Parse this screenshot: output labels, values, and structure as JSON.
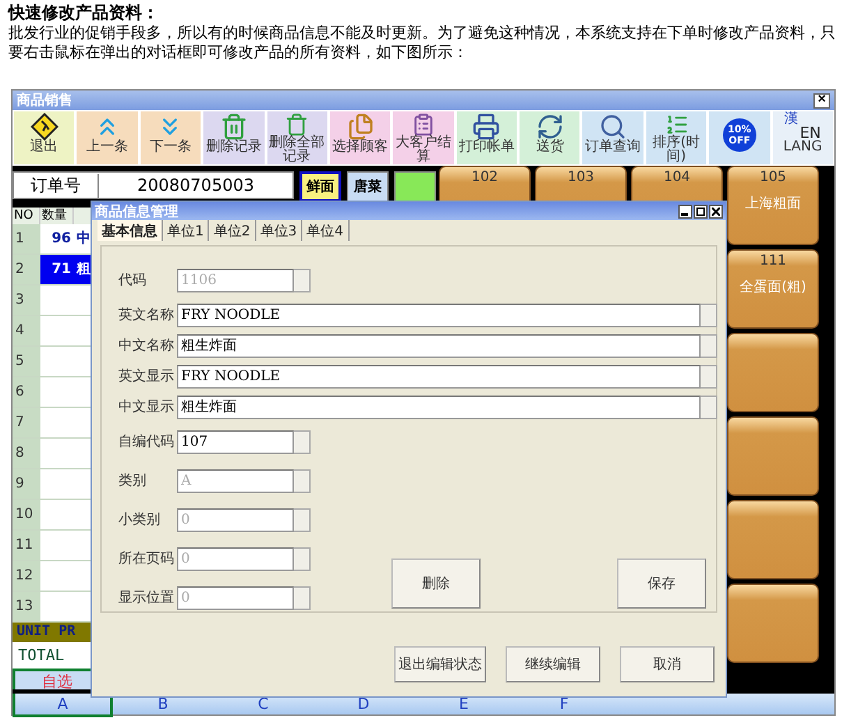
{
  "heading": "快速修改产品资料：",
  "intro": "批发行业的促销手段多，所以有的时候商品信息不能及时更新。为了避免这种情况，本系统支持在下单时修改产品资料，只要右击鼠标在弹出的对话框即可修改产品的所有资料，如下图所示：",
  "window": {
    "title": "商品销售",
    "close": "×"
  },
  "toolbar": [
    {
      "label": "退出",
      "color": "#eef3c4"
    },
    {
      "label": "上一条",
      "color": "#f6dcbc"
    },
    {
      "label": "下一条",
      "color": "#f6dcbc"
    },
    {
      "label": "删除记录",
      "color": "#dcd8f0"
    },
    {
      "label": "删除全部记录",
      "color": "#dcd8f0"
    },
    {
      "label": "选择顾客",
      "color": "#f4d0e8"
    },
    {
      "label": "大客户结算",
      "color": "#f4d0e8"
    },
    {
      "label": "打印帐单",
      "color": "#d4f0d8"
    },
    {
      "label": "送货",
      "color": "#d4f0d8"
    },
    {
      "label": "订单查询",
      "color": "#d0e4f4"
    },
    {
      "label": "排序(时间)",
      "color": "#d0e4f4"
    },
    {
      "badge": "10% OFF",
      "color": "#d0e4f4"
    },
    {
      "label": "LANG",
      "glyphs": [
        "漢",
        "EN"
      ],
      "color": "#e8f0f8"
    }
  ],
  "order": {
    "label": "订单号",
    "number": "20080705003"
  },
  "categories": [
    {
      "label": "鲜面",
      "selected": true,
      "color": "#f8f080"
    },
    {
      "label": "唐菜",
      "selected": false,
      "color": "#c8dcf4"
    },
    {
      "selected": false,
      "color": "#88e858"
    }
  ],
  "order_table": {
    "columns": [
      "NO",
      "数量"
    ],
    "rows": [
      {
        "no": "1",
        "qty": "96",
        "name": "中",
        "selected": false
      },
      {
        "no": "2",
        "qty": "71",
        "name": "粗",
        "selected": true
      },
      {
        "no": "3",
        "selected": false
      },
      {
        "no": "4",
        "selected": false
      },
      {
        "no": "5",
        "selected": false
      },
      {
        "no": "6",
        "selected": false
      },
      {
        "no": "7",
        "selected": false
      },
      {
        "no": "8",
        "selected": false
      },
      {
        "no": "9",
        "selected": false
      },
      {
        "no": "10",
        "selected": false
      },
      {
        "no": "11",
        "selected": false
      },
      {
        "no": "12",
        "selected": false
      },
      {
        "no": "13",
        "selected": false
      }
    ],
    "unit_price_label": "UNIT PR",
    "total_label": "TOTAL",
    "custom_label": "自选"
  },
  "products": [
    {
      "kind": "item",
      "code": "102"
    },
    {
      "kind": "item",
      "code": "103"
    },
    {
      "kind": "item",
      "code": "104"
    },
    {
      "kind": "item",
      "code": "105",
      "name": "上海粗面"
    },
    {
      "kind": "item",
      "code": "111",
      "name": "全蛋面(粗)"
    },
    {
      "kind": "blank"
    },
    {
      "kind": "blank"
    },
    {
      "kind": "blank"
    },
    {
      "kind": "blank"
    }
  ],
  "column_letters": [
    {
      "letter": "A",
      "selected": true
    },
    {
      "letter": "B",
      "selected": false
    },
    {
      "letter": "C",
      "selected": false
    },
    {
      "letter": "D",
      "selected": false
    },
    {
      "letter": "E",
      "selected": false
    },
    {
      "letter": "F",
      "selected": false
    }
  ],
  "dialog": {
    "title": "商品信息管理",
    "tabs": [
      {
        "label": "基本信息",
        "selected": true
      },
      {
        "label": "单位1",
        "selected": false
      },
      {
        "label": "单位2",
        "selected": false
      },
      {
        "label": "单位3",
        "selected": false
      },
      {
        "label": "单位4",
        "selected": false
      }
    ],
    "fields": [
      {
        "label": "代码",
        "value": "1106",
        "kind": "short",
        "disabled": true
      },
      {
        "label": "英文名称",
        "value": "FRY NOODLE",
        "kind": "long",
        "disabled": false
      },
      {
        "label": "中文名称",
        "value": "粗生炸面",
        "kind": "long",
        "disabled": false
      },
      {
        "label": "英文显示",
        "value": "FRY NOODLE",
        "kind": "long",
        "disabled": false
      },
      {
        "label": "中文显示",
        "value": "粗生炸面",
        "kind": "long",
        "disabled": false
      },
      {
        "label": "自编代码",
        "value": "107",
        "kind": "short",
        "disabled": false
      },
      {
        "label": "类别",
        "value": "A",
        "kind": "short",
        "disabled": true
      },
      {
        "label": "小类别",
        "value": "0",
        "kind": "short",
        "disabled": true
      },
      {
        "label": "所在页码",
        "value": "0",
        "kind": "short",
        "disabled": true
      },
      {
        "label": "显示位置",
        "value": "0",
        "kind": "short",
        "disabled": true
      }
    ],
    "delete_button": "删除",
    "save_button": "保存",
    "footer_buttons": [
      "退出编辑状态",
      "继续编辑",
      "取消"
    ]
  }
}
